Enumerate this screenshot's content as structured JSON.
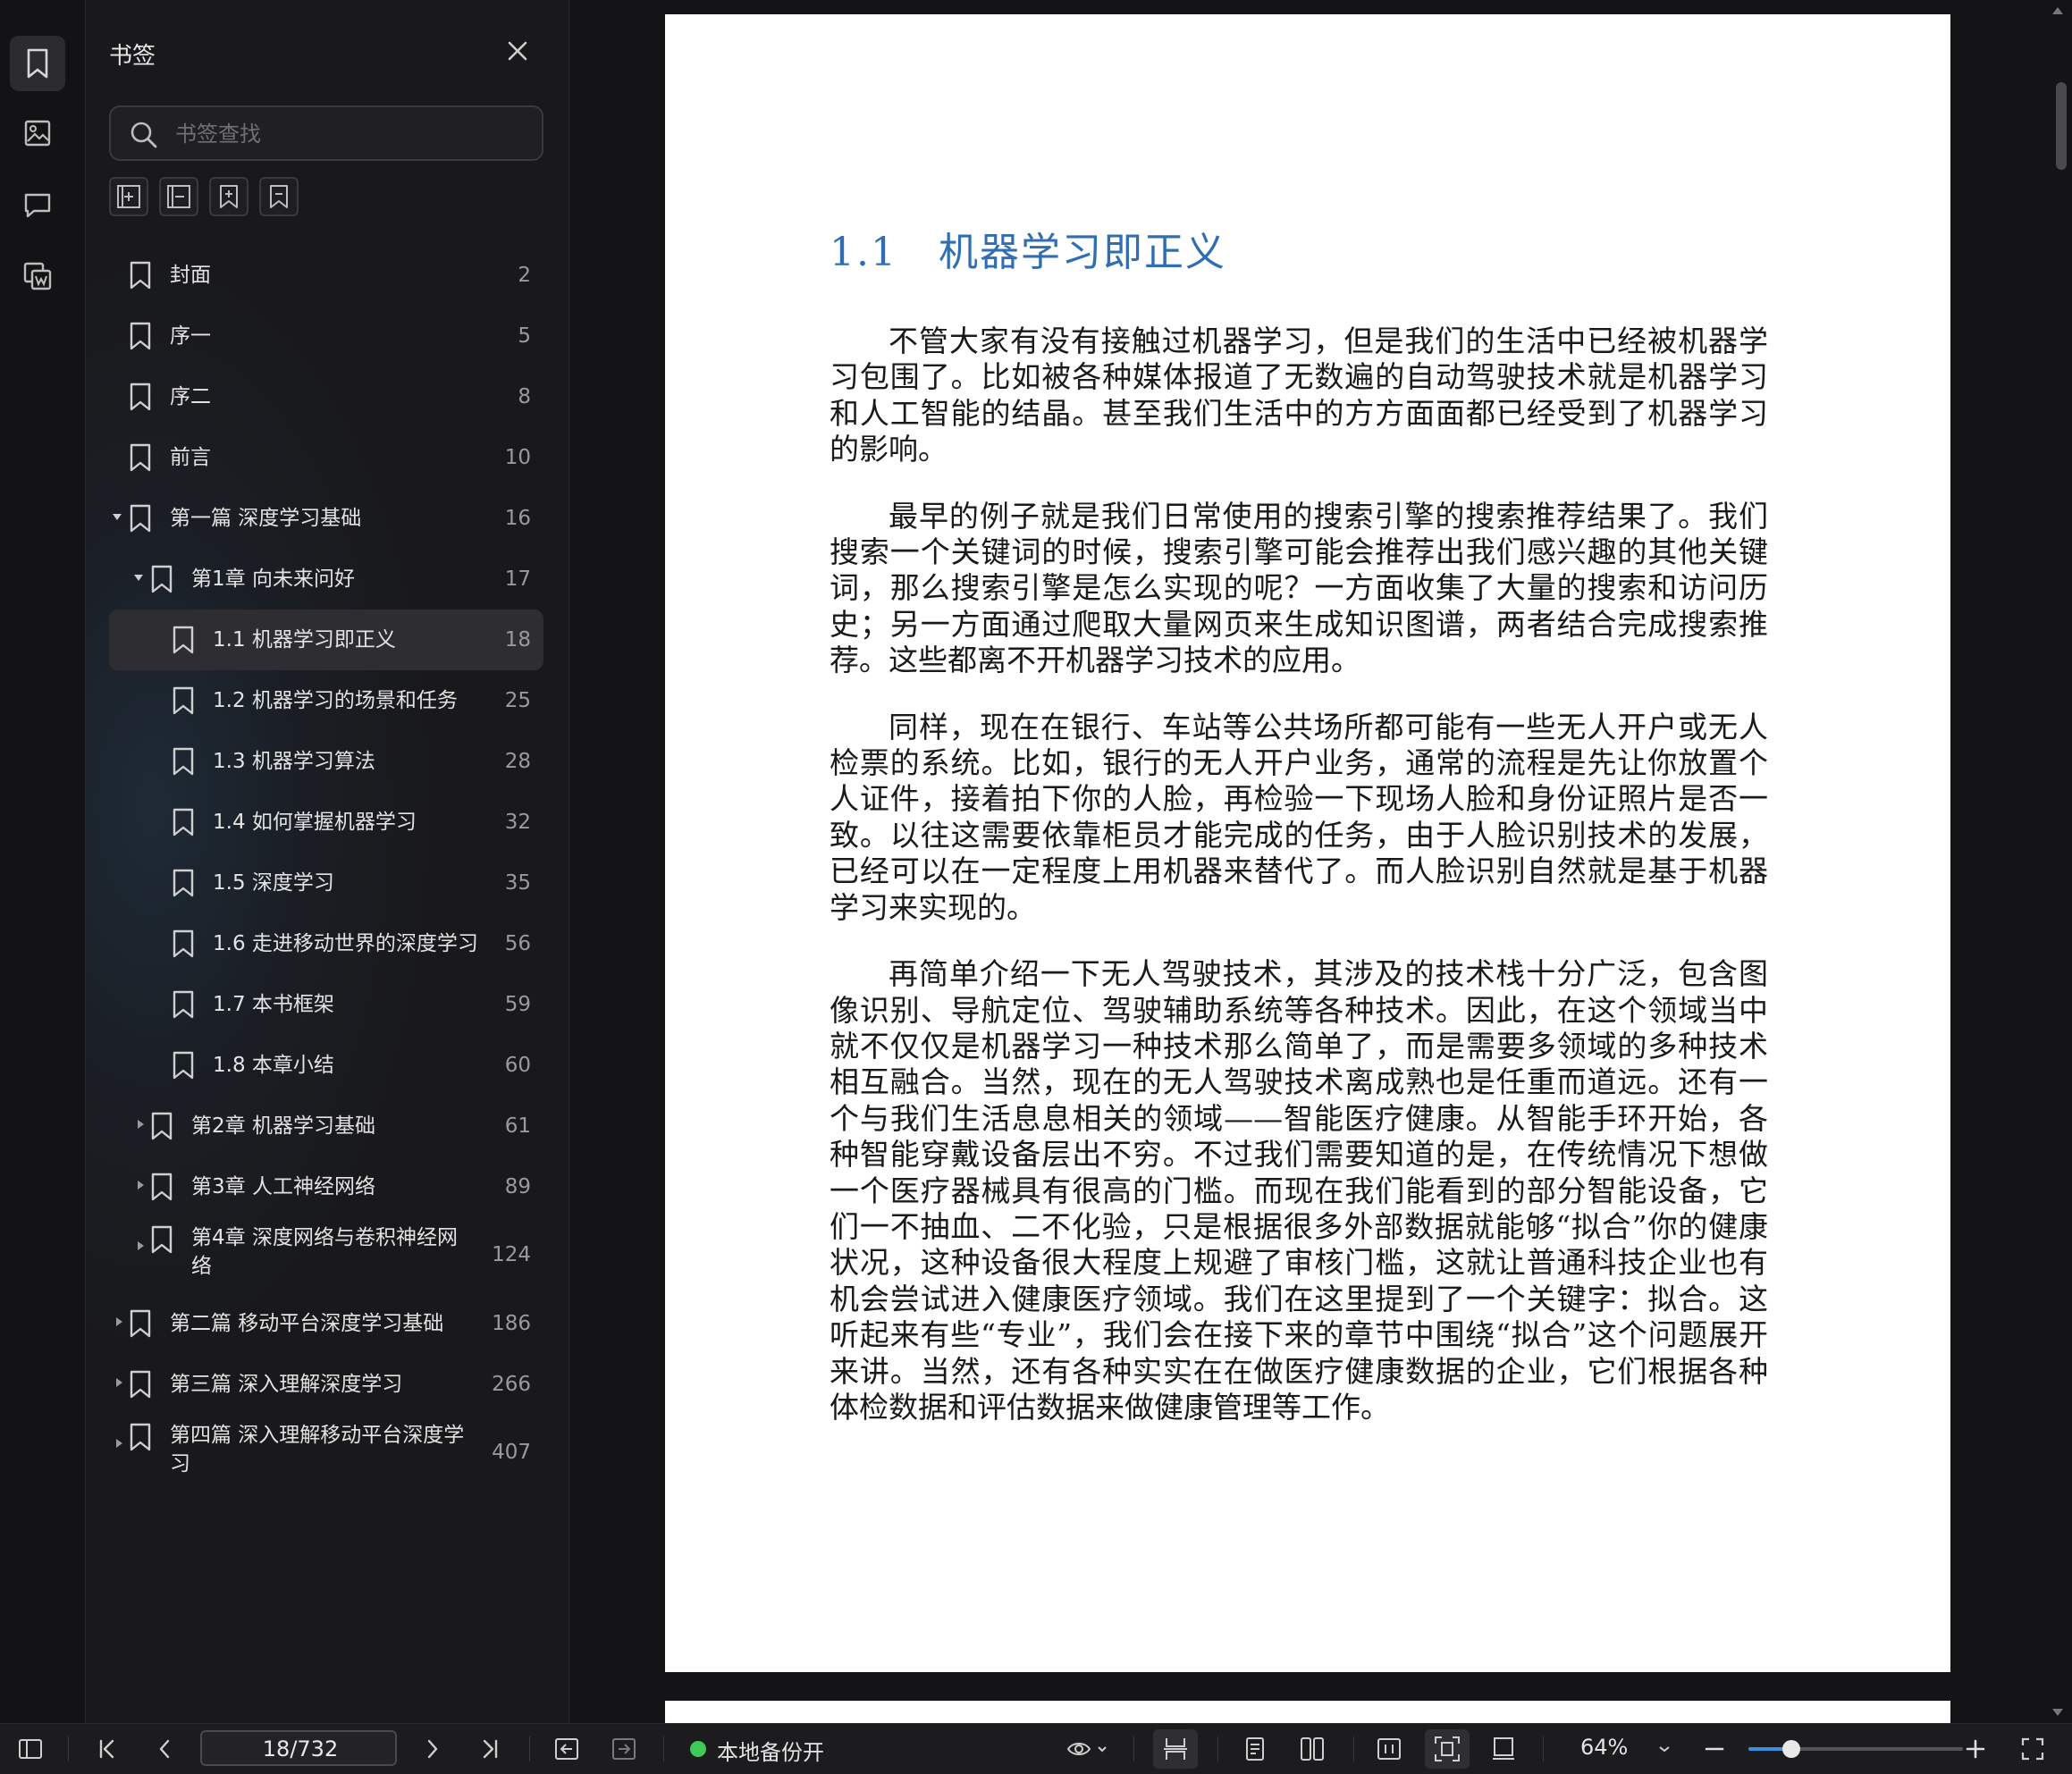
{
  "panel": {
    "title": "书签",
    "search_placeholder": "书签查找"
  },
  "bookmarks": [
    {
      "label": "封面",
      "page": "2"
    },
    {
      "label": "序一",
      "page": "5"
    },
    {
      "label": "序二",
      "page": "8"
    },
    {
      "label": "前言",
      "page": "10"
    },
    {
      "label": "第一篇 深度学习基础",
      "page": "16"
    },
    {
      "label": "第1章 向未来问好",
      "page": "17"
    },
    {
      "label": "1.1 机器学习即正义",
      "page": "18"
    },
    {
      "label": "1.2 机器学习的场景和任务",
      "page": "25"
    },
    {
      "label": "1.3 机器学习算法",
      "page": "28"
    },
    {
      "label": "1.4 如何掌握机器学习",
      "page": "32"
    },
    {
      "label": "1.5 深度学习",
      "page": "35"
    },
    {
      "label": "1.6 走进移动世界的深度学习",
      "page": "56"
    },
    {
      "label": "1.7 本书框架",
      "page": "59"
    },
    {
      "label": "1.8 本章小结",
      "page": "60"
    },
    {
      "label": "第2章 机器学习基础",
      "page": "61"
    },
    {
      "label": "第3章 人工神经网络",
      "page": "89"
    },
    {
      "label": "第4章 深度网络与卷积神经网络",
      "page": "124"
    },
    {
      "label": "第二篇 移动平台深度学习基础",
      "page": "186"
    },
    {
      "label": "第三篇 深入理解深度学习",
      "page": "266"
    },
    {
      "label": "第四篇 深入理解移动平台深度学习",
      "page": "407"
    }
  ],
  "document": {
    "section_title": "1.1　机器学习即正义",
    "paragraphs": [
      "不管大家有没有接触过机器学习，但是我们的生活中已经被机器学习包围了。比如被各种媒体报道了无数遍的自动驾驶技术就是机器学习和人工智能的结晶。甚至我们生活中的方方面面都已经受到了机器学习的影响。",
      "最早的例子就是我们日常使用的搜索引擎的搜索推荐结果了。我们搜索一个关键词的时候，搜索引擎可能会推荐出我们感兴趣的其他关键词，那么搜索引擎是怎么实现的呢？一方面收集了大量的搜索和访问历史；另一方面通过爬取大量网页来生成知识图谱，两者结合完成搜索推荐。这些都离不开机器学习技术的应用。",
      "同样，现在在银行、车站等公共场所都可能有一些无人开户或无人检票的系统。比如，银行的无人开户业务，通常的流程是先让你放置个人证件，接着拍下你的人脸，再检验一下现场人脸和身份证照片是否一致。以往这需要依靠柜员才能完成的任务，由于人脸识别技术的发展，已经可以在一定程度上用机器来替代了。而人脸识别自然就是基于机器学习来实现的。",
      "再简单介绍一下无人驾驶技术，其涉及的技术栈十分广泛，包含图像识别、导航定位、驾驶辅助系统等各种技术。因此，在这个领域当中就不仅仅是机器学习一种技术那么简单了，而是需要多领域的多种技术相互融合。当然，现在的无人驾驶技术离成熟也是任重而道远。还有一个与我们生活息息相关的领域——智能医疗健康。从智能手环开始，各种智能穿戴设备层出不穷。不过我们需要知道的是，在传统情况下想做一个医疗器械具有很高的门槛。而现在我们能看到的部分智能设备，它们一不抽血、二不化验，只是根据很多外部数据就能够“拟合”你的健康状况，这种设备很大程度上规避了审核门槛，这就让普通科技企业也有机会尝试进入健康医疗领域。我们在这里提到了一个关键字：拟合。这听起来有些“专业”，我们会在接下来的章节中围绕“拟合”这个问题展开来讲。当然，还有各种实实在在做医疗健康数据的企业，它们根据各种体检数据和评估数据来做健康管理等工作。"
    ]
  },
  "bottombar": {
    "page_value": "18/732",
    "backup_status": "本地备份开",
    "zoom": "64%",
    "zoom_level": 0.2
  },
  "colors": {
    "accent": "#3a8fe0",
    "heading": "#2f6eb3",
    "status_ok": "#3ec95b"
  }
}
